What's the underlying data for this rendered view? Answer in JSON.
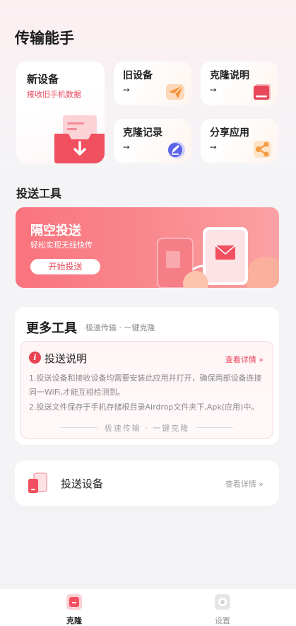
{
  "page": {
    "title": "传输能手"
  },
  "cards": {
    "new_device": {
      "title": "新设备",
      "subtitle": "接收旧手机数据"
    },
    "old_device": {
      "title": "旧设备",
      "arrow": "➙"
    },
    "clone_help": {
      "title": "克隆说明",
      "arrow": "➙"
    },
    "clone_record": {
      "title": "克隆记录",
      "arrow": "➙"
    },
    "share_app": {
      "title": "分享应用",
      "arrow": "➙"
    }
  },
  "tools": {
    "section_title": "投送工具",
    "banner": {
      "title": "隔空投送",
      "subtitle": "轻松实现无线快传",
      "button": "开始投送"
    }
  },
  "more": {
    "title": "更多工具",
    "subtitle": "极速传输 · 一键克隆",
    "info": {
      "badge": "i",
      "title": "投送说明",
      "link": "查看详情 »",
      "para1": "1.投送设备和接收设备均需要安装此应用并打开，确保两部设备连接同一WiFi,才能互相检测到。",
      "para2": "2.投送文件保存于手机存储根目录Airdrop文件夹下,Apk(应用)中。",
      "footer": "极速传输 · 一键克隆"
    }
  },
  "devices": {
    "title": "投送设备",
    "link": "查看详情 »"
  },
  "tabbar": {
    "tabs": [
      {
        "label": "克隆",
        "active": true
      },
      {
        "label": "设置",
        "active": false
      }
    ]
  },
  "colors": {
    "accent": "#e8475a",
    "banner_start": "#f9747e",
    "banner_end": "#fba2a4"
  }
}
